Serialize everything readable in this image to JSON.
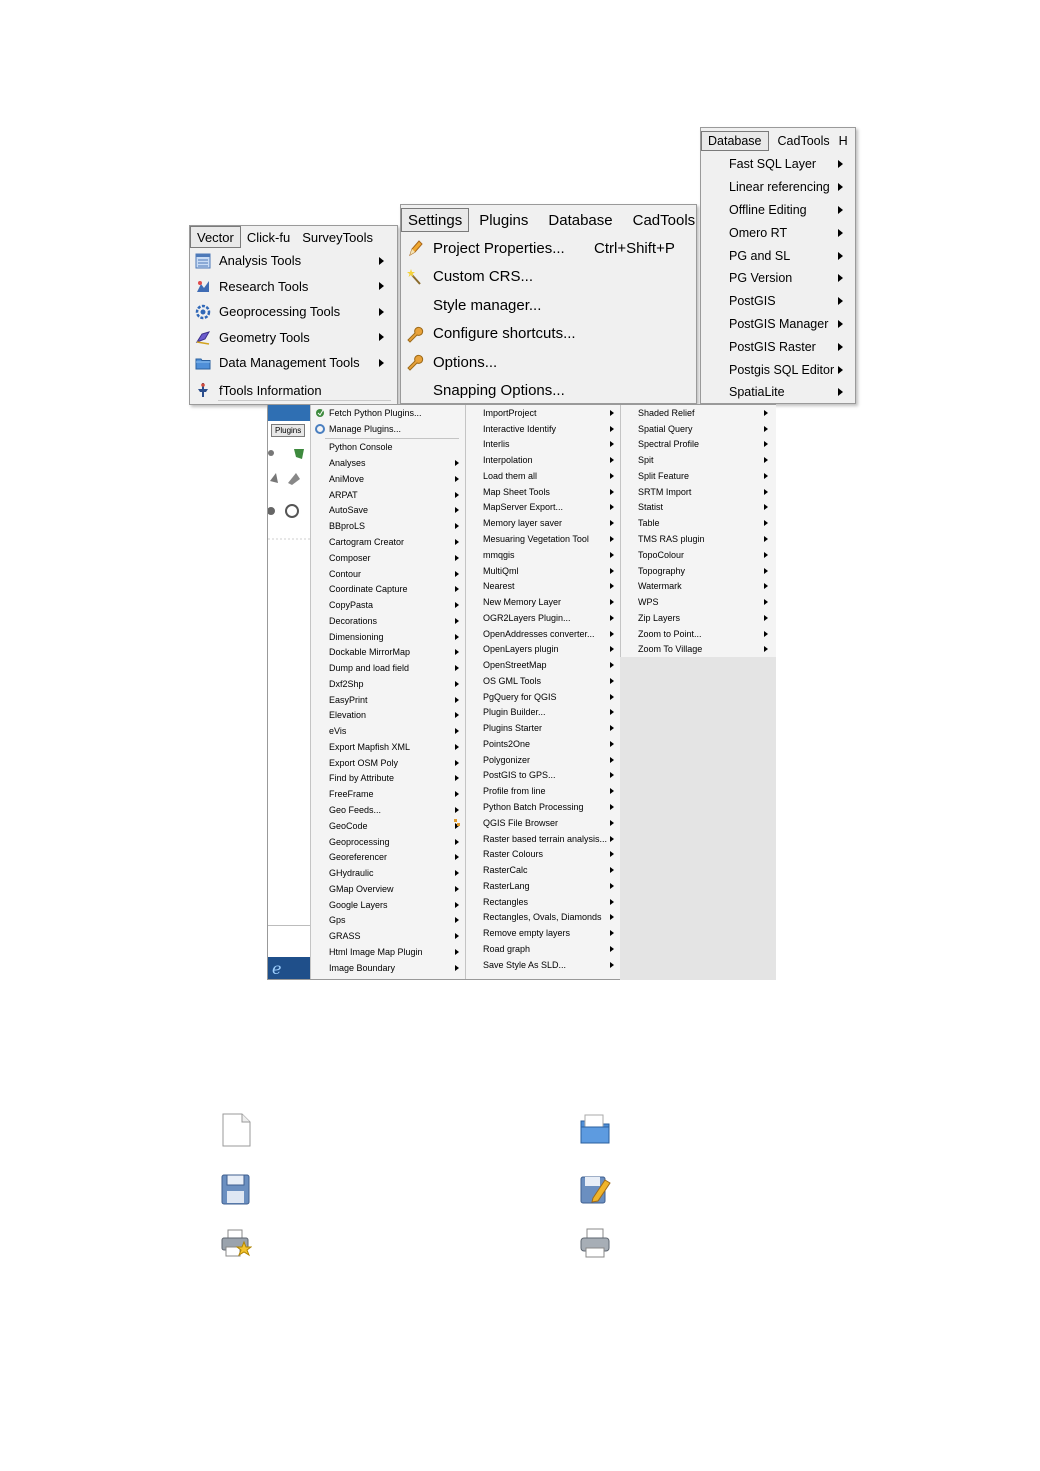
{
  "vector_menu": {
    "menubar": [
      "Vector",
      "Click-fu",
      "SurveyTools"
    ],
    "items": [
      {
        "label": "Analysis Tools",
        "icon": "analysis-icon",
        "submenu": true
      },
      {
        "label": "Research Tools",
        "icon": "research-icon",
        "submenu": true
      },
      {
        "label": "Geoprocessing Tools",
        "icon": "geoprocessing-icon",
        "submenu": true
      },
      {
        "label": "Geometry Tools",
        "icon": "geometry-icon",
        "submenu": true
      },
      {
        "label": "Data Management Tools",
        "icon": "folder-icon",
        "submenu": true
      },
      {
        "label": "fTools Information",
        "icon": "info-icon",
        "submenu": false
      }
    ]
  },
  "settings_menu": {
    "menubar": [
      "Settings",
      "Plugins",
      "Database",
      "CadTools"
    ],
    "items": [
      {
        "label": "Project Properties...",
        "shortcut": "Ctrl+Shift+P",
        "icon": "pencil-icon"
      },
      {
        "label": "Custom CRS...",
        "shortcut": "",
        "icon": "wand-icon"
      },
      {
        "label": "Style manager...",
        "shortcut": "",
        "icon": ""
      },
      {
        "label": "Configure shortcuts...",
        "shortcut": "",
        "icon": "wrench-icon"
      },
      {
        "label": "Options...",
        "shortcut": "",
        "icon": "wrench-icon"
      },
      {
        "label": "Snapping Options...",
        "shortcut": "",
        "icon": ""
      }
    ]
  },
  "database_menu": {
    "menubar": [
      "Database",
      "CadTools",
      "H"
    ],
    "items": [
      "Fast SQL Layer",
      "Linear referencing",
      "Offline Editing",
      "Omero RT",
      "PG and SL",
      "PG Version",
      "PostGIS",
      "PostGIS Manager",
      "PostGIS Raster",
      "Postgis SQL Editor",
      "SpatiaLite"
    ]
  },
  "plugins_menu": {
    "plugins_tag": "Plugins",
    "col1": [
      {
        "label": "Fetch Python Plugins...",
        "submenu": false,
        "icon": "fetch-plugins-icon"
      },
      {
        "label": "Manage Plugins...",
        "submenu": false,
        "icon": "manage-plugins-icon"
      },
      {
        "label": "Python Console",
        "submenu": false
      },
      {
        "label": "Analyses",
        "submenu": true
      },
      {
        "label": "AniMove",
        "submenu": true
      },
      {
        "label": "ARPAT",
        "submenu": true
      },
      {
        "label": "AutoSave",
        "submenu": true
      },
      {
        "label": "BBproLS",
        "submenu": true
      },
      {
        "label": "Cartogram Creator",
        "submenu": true
      },
      {
        "label": "Composer",
        "submenu": true
      },
      {
        "label": "Contour",
        "submenu": true
      },
      {
        "label": "Coordinate Capture",
        "submenu": true
      },
      {
        "label": "CopyPasta",
        "submenu": true
      },
      {
        "label": "Decorations",
        "submenu": true
      },
      {
        "label": "Dimensioning",
        "submenu": true
      },
      {
        "label": "Dockable MirrorMap",
        "submenu": true
      },
      {
        "label": "Dump and load field",
        "submenu": true
      },
      {
        "label": "Dxf2Shp",
        "submenu": true
      },
      {
        "label": "EasyPrint",
        "submenu": true
      },
      {
        "label": "Elevation",
        "submenu": true
      },
      {
        "label": "eVis",
        "submenu": true
      },
      {
        "label": "Export Mapfish XML",
        "submenu": true
      },
      {
        "label": "Export OSM Poly",
        "submenu": true
      },
      {
        "label": "Find by Attribute",
        "submenu": true
      },
      {
        "label": "FreeFrame",
        "submenu": true
      },
      {
        "label": "Geo Feeds...",
        "submenu": true
      },
      {
        "label": "GeoCode",
        "submenu": true
      },
      {
        "label": "Geoprocessing",
        "submenu": true
      },
      {
        "label": "Georeferencer",
        "submenu": true
      },
      {
        "label": "GHydraulic",
        "submenu": true
      },
      {
        "label": "GMap Overview",
        "submenu": true
      },
      {
        "label": "Google Layers",
        "submenu": true
      },
      {
        "label": "Gps",
        "submenu": true
      },
      {
        "label": "GRASS",
        "submenu": true
      },
      {
        "label": "Html Image Map Plugin",
        "submenu": true
      },
      {
        "label": "Image Boundary",
        "submenu": true
      }
    ],
    "col2": [
      "ImportProject",
      "Interactive Identify",
      "Interlis",
      "Interpolation",
      "Load them all",
      "Map Sheet Tools",
      "MapServer Export...",
      "Memory layer saver",
      "Mesuaring Vegetation Tool",
      "mmqgis",
      "MultiQml",
      "Nearest",
      "New Memory Layer",
      "OGR2Layers Plugin...",
      "OpenAddresses converter...",
      "OpenLayers plugin",
      "OpenStreetMap",
      "OS GML Tools",
      "PgQuery for QGIS",
      "Plugin Builder...",
      "Plugins Starter",
      "Points2One",
      "Polygonizer",
      "PostGIS to GPS...",
      "Profile from line",
      "Python Batch Processing",
      "QGIS File Browser",
      "Raster based terrain analysis...",
      "Raster Colours",
      "RasterCalc",
      "RasterLang",
      "Rectangles",
      "Rectangles, Ovals, Diamonds",
      "Remove empty layers",
      "Road graph",
      "Save Style As SLD..."
    ],
    "col3": [
      "Shaded Relief",
      "Spatial Query",
      "Spectral Profile",
      "Spit",
      "Split Feature",
      "SRTM Import",
      "Statist",
      "Table",
      "TMS RAS plugin",
      "TopoColour",
      "Topography",
      "Watermark",
      "WPS",
      "Zip Layers",
      "Zoom to Point...",
      "Zoom To Village"
    ]
  },
  "toolbar_icons": [
    "new-document-icon",
    "open-folder-icon",
    "save-icon",
    "save-as-icon",
    "new-print-composer-icon",
    "print-icon"
  ]
}
